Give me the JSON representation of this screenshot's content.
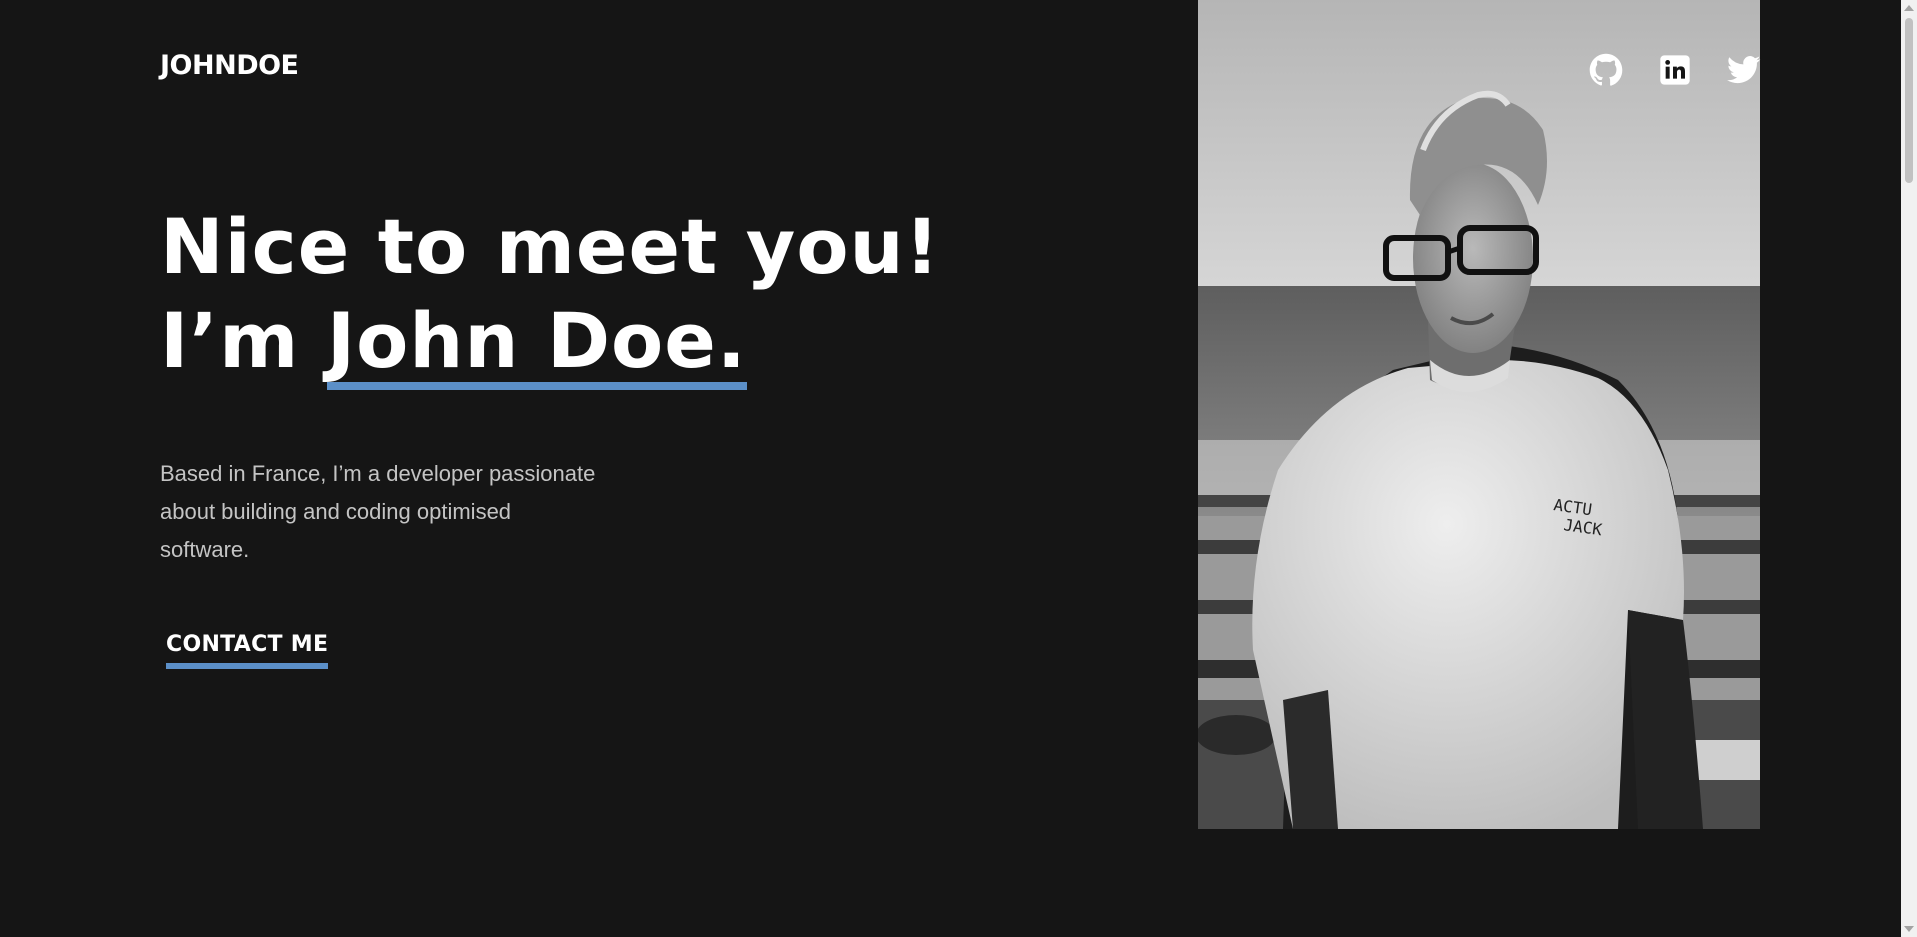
{
  "header": {
    "logo": "JOHNDOE"
  },
  "hero": {
    "headline_line1": "Nice to meet you!",
    "headline_prefix": "I’m ",
    "headline_name": "John Doe.",
    "intro": "Based in France, I’m a developer passionate about building and coding optimised software.",
    "contact_label": "CONTACT ME"
  },
  "socials": [
    {
      "name": "github",
      "icon": "github-icon"
    },
    {
      "name": "linkedin",
      "icon": "linkedin-icon"
    },
    {
      "name": "twitter",
      "icon": "twitter-icon"
    }
  ],
  "colors": {
    "background": "#151515",
    "accent": "#5b8fc8",
    "text": "#ffffff",
    "muted_text": "#c4c4c4"
  }
}
